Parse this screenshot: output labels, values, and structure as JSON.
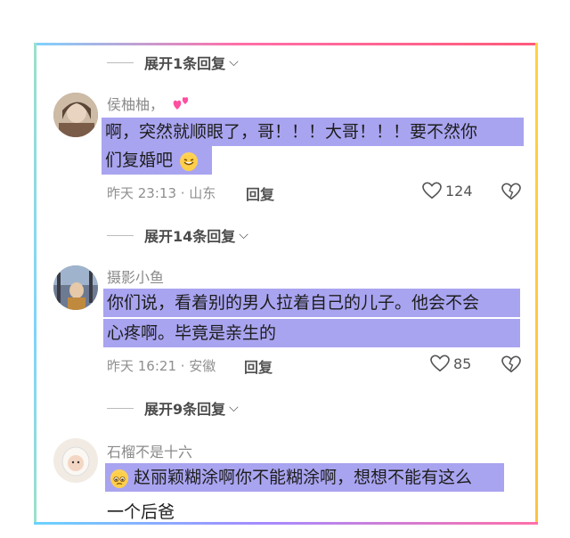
{
  "thread": {
    "expand_1": "展开1条回复",
    "expand_2": "展开14条回复",
    "expand_3": "展开9条回复"
  },
  "comments": [
    {
      "username": "侯柚柚，",
      "line1": "啊，突然就顺眼了，哥！！！大哥！！！要不然你",
      "line2": "们复婚吧",
      "time": "昨天 23:13 · 山东",
      "reply": "回复",
      "likes": "124"
    },
    {
      "username": "摄影小鱼",
      "line1": "你们说，看着别的男人拉着自己的儿子。他会不会",
      "line2": "心疼啊。毕竟是亲生的",
      "time": "昨天 16:21 · 安徽",
      "reply": "回复",
      "likes": "85"
    },
    {
      "username": "石榴不是十六",
      "line1": "赵丽颖糊涂啊你不能糊涂啊，想想不能有这么",
      "line2": "一个后爸"
    }
  ],
  "icons": {
    "heart": "heart-outline-icon",
    "dislike": "broken-heart-icon",
    "chevron": "chevron-down-icon"
  }
}
